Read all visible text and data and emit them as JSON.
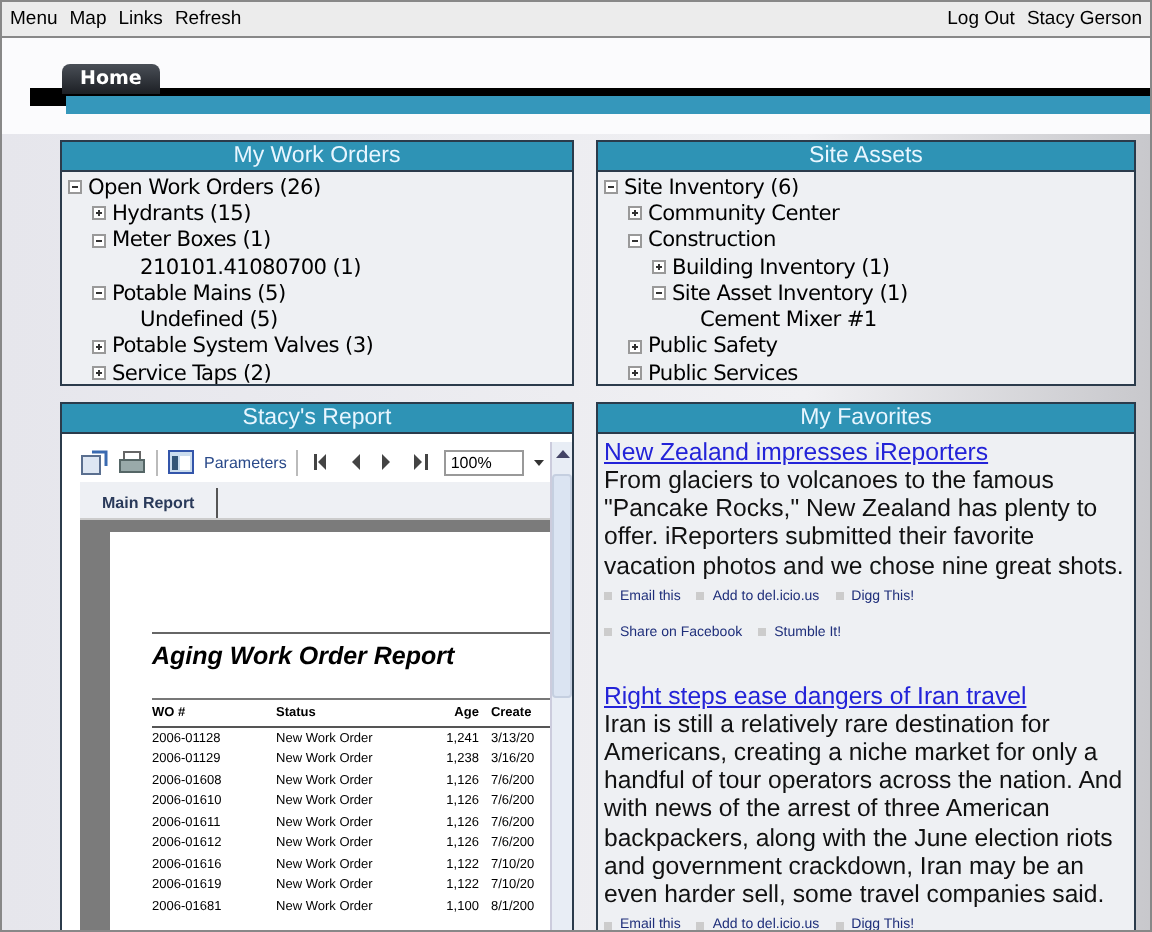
{
  "menu_bar": {
    "left": [
      "Menu",
      "Map",
      "Links",
      "Refresh"
    ],
    "right": [
      "Log Out",
      "Stacy Gerson"
    ]
  },
  "tabs": [
    {
      "label": "Home",
      "selected": true
    }
  ],
  "work_orders": {
    "title": "My Work Orders",
    "tree": [
      {
        "label": "Open Work Orders (26)",
        "expanded": true,
        "children": [
          {
            "label": "Hydrants (15)",
            "expanded": false
          },
          {
            "label": "Meter Boxes (1)",
            "expanded": true,
            "children": [
              {
                "label": "210101.41080700 (1)"
              }
            ]
          },
          {
            "label": "Potable Mains (5)",
            "expanded": true,
            "children": [
              {
                "label": "Undefined (5)"
              }
            ]
          },
          {
            "label": "Potable System Valves (3)",
            "expanded": false
          },
          {
            "label": "Service Taps (2)",
            "expanded": false
          }
        ]
      }
    ]
  },
  "site_assets": {
    "title": "Site Assets",
    "tree": [
      {
        "label": "Site Inventory (6)",
        "expanded": true,
        "children": [
          {
            "label": "Community Center",
            "expanded": false
          },
          {
            "label": "Construction",
            "expanded": true,
            "children": [
              {
                "label": "Building Inventory (1)",
                "expanded": false
              },
              {
                "label": "Site Asset Inventory (1)",
                "expanded": true,
                "children": [
                  {
                    "label": "Cement Mixer #1"
                  }
                ]
              }
            ]
          },
          {
            "label": "Public Safety",
            "expanded": false
          },
          {
            "label": "Public Services",
            "expanded": false
          }
        ]
      }
    ]
  },
  "report": {
    "title": "Stacy's Report",
    "parameters": "Parameters",
    "zoom": "100%",
    "tab": "Main Report",
    "heading": "Aging Work Order Report",
    "columns": [
      "WO #",
      "Status",
      "Age",
      "Create"
    ],
    "rows": [
      [
        "2006-01128",
        "New Work Order",
        "1,241",
        "3/13/20"
      ],
      [
        "2006-01129",
        "New Work Order",
        "1,238",
        "3/16/20"
      ],
      [
        "2006-01608",
        "New Work Order",
        "1,126",
        "7/6/200"
      ],
      [
        "2006-01610",
        "New Work Order",
        "1,126",
        "7/6/200"
      ],
      [
        "2006-01611",
        "New Work Order",
        "1,126",
        "7/6/200"
      ],
      [
        "2006-01612",
        "New Work Order",
        "1,126",
        "7/6/200"
      ],
      [
        "2006-01616",
        "New Work Order",
        "1,122",
        "7/10/20"
      ],
      [
        "2006-01619",
        "New Work Order",
        "1,122",
        "7/10/20"
      ],
      [
        "2006-01681",
        "New Work Order",
        "1,100",
        "8/1/200"
      ]
    ]
  },
  "favorites": {
    "title": "My Favorites",
    "stories": [
      {
        "headline": "New Zealand impresses iReporters",
        "body": "From glaciers to volcanoes to the famous \"Pancake Rocks,\" New Zealand has plenty to offer. iReporters submitted their favorite vacation photos and we chose nine great shots.",
        "links": [
          "Email this",
          "Add to del.icio.us",
          "Digg This!",
          "Share on Facebook",
          "Stumble It!"
        ]
      },
      {
        "headline": "Right steps ease dangers of Iran travel",
        "body": "Iran is still a relatively rare destination for Americans, creating a niche market for only a handful of tour operators across the nation. And with news of the arrest of three American backpackers, along with the June election riots and government crackdown, Iran may be an even harder sell, some travel companies said.",
        "links": [
          "Email this",
          "Add to del.icio.us",
          "Digg This!"
        ]
      }
    ]
  }
}
